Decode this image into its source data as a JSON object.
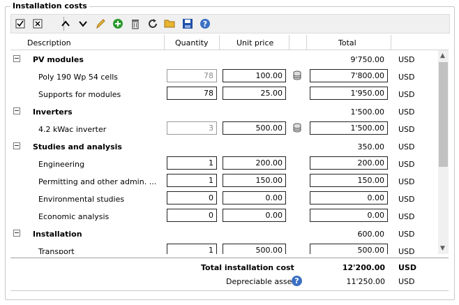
{
  "panel": {
    "title": "Installation costs"
  },
  "toolbar": {
    "icons": [
      "check-all-icon",
      "uncheck-all-icon",
      "move-up-icon",
      "move-down-icon",
      "edit-icon",
      "add-icon",
      "delete-icon",
      "refresh-icon",
      "open-icon",
      "save-icon",
      "help-icon"
    ]
  },
  "columns": {
    "description": "Description",
    "quantity": "Quantity",
    "unit_price": "Unit price",
    "total": "Total"
  },
  "groups": [
    {
      "label": "PV modules",
      "total": "9'750.00",
      "currency": "USD",
      "items": [
        {
          "label": "Poly 190 Wp  54 cells",
          "quantity": "78",
          "quantity_dim": true,
          "unit_price": "100.00",
          "db": true,
          "total": "7'800.00",
          "currency": "USD"
        },
        {
          "label": "Supports for modules",
          "quantity": "78",
          "quantity_dim": false,
          "unit_price": "25.00",
          "db": false,
          "total": "1'950.00",
          "currency": "USD"
        }
      ]
    },
    {
      "label": "Inverters",
      "total": "1'500.00",
      "currency": "USD",
      "items": [
        {
          "label": "4.2 kWac inverter",
          "quantity": "3",
          "quantity_dim": true,
          "unit_price": "500.00",
          "db": true,
          "total": "1'500.00",
          "currency": "USD"
        }
      ]
    },
    {
      "label": "Studies and analysis",
      "total": "350.00",
      "currency": "USD",
      "items": [
        {
          "label": "Engineering",
          "quantity": "1",
          "quantity_dim": false,
          "unit_price": "200.00",
          "db": false,
          "total": "200.00",
          "currency": "USD"
        },
        {
          "label": "Permitting and other admin. ...",
          "quantity": "1",
          "quantity_dim": false,
          "unit_price": "150.00",
          "db": false,
          "total": "150.00",
          "currency": "USD"
        },
        {
          "label": "Environmental studies",
          "quantity": "0",
          "quantity_dim": false,
          "unit_price": "0.00",
          "db": false,
          "total": "0.00",
          "currency": "USD"
        },
        {
          "label": "Economic analysis",
          "quantity": "0",
          "quantity_dim": false,
          "unit_price": "0.00",
          "db": false,
          "total": "0.00",
          "currency": "USD"
        }
      ]
    },
    {
      "label": "Installation",
      "total": "600.00",
      "currency": "USD",
      "items": [
        {
          "label": "Transport",
          "quantity": "1",
          "quantity_dim": false,
          "unit_price": "500.00",
          "db": false,
          "total": "500.00",
          "currency": "USD"
        }
      ]
    }
  ],
  "footer": {
    "total_label": "Total installation cost",
    "total_value": "12'200.00",
    "total_currency": "USD",
    "depreciable_label": "Depreciable asset",
    "depreciable_value": "11'250.00",
    "depreciable_currency": "USD",
    "help_glyph": "?"
  },
  "colors": {
    "help_blue": "#3b6fc4",
    "add_green": "#2e9a2e",
    "save_blue": "#1f4fa8",
    "folder_yellow": "#e8b530"
  }
}
